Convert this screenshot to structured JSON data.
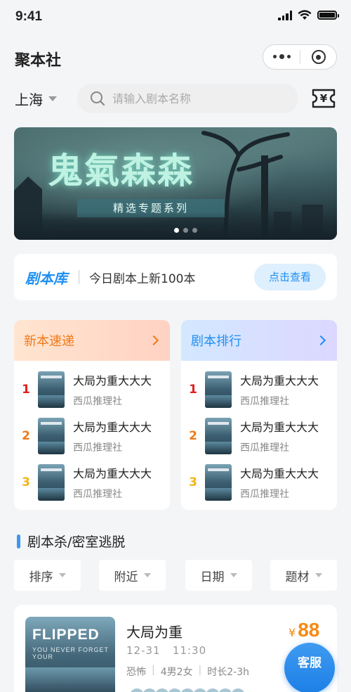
{
  "status_bar": {
    "time": "9:41"
  },
  "nav": {
    "title": "聚本社"
  },
  "location": {
    "city": "上海"
  },
  "search": {
    "placeholder": "请输入剧本名称"
  },
  "banner": {
    "title": "鬼氣森森",
    "subtitle": "精选专题系列",
    "pages": 3,
    "active_page": 1
  },
  "library": {
    "brand": "剧本库",
    "text": "今日剧本上新100本",
    "button": "点击查看"
  },
  "new_releases": {
    "title": "新本速递",
    "items": [
      {
        "rank": "1",
        "title": "大局为重大大大",
        "publisher": "西瓜推理社"
      },
      {
        "rank": "2",
        "title": "大局为重大大大",
        "publisher": "西瓜推理社"
      },
      {
        "rank": "3",
        "title": "大局为重大大大",
        "publisher": "西瓜推理社"
      }
    ]
  },
  "rankings": {
    "title": "剧本排行",
    "items": [
      {
        "rank": "1",
        "title": "大局为重大大大",
        "publisher": "西瓜推理社"
      },
      {
        "rank": "2",
        "title": "大局为重大大大",
        "publisher": "西瓜推理社"
      },
      {
        "rank": "3",
        "title": "大局为重大大大",
        "publisher": "西瓜推理社"
      }
    ]
  },
  "section": {
    "title": "剧本杀/密室逃脱"
  },
  "filters": [
    "排序",
    "附近",
    "日期",
    "题材"
  ],
  "listing": {
    "poster_title": "FLIPPED",
    "poster_subtitle": "YOU NEVER FORGET YOUR",
    "name": "大局为重",
    "date": "12-31",
    "time": "11:30",
    "genre": "恐怖",
    "cast": "4男2女",
    "duration": "时长2-3h",
    "currency": "¥",
    "price": "88"
  },
  "service_button": "客服",
  "colors": {
    "accent_blue": "#1f8ff2",
    "accent_orange": "#f07a1a",
    "rank1": "#e02020",
    "rank2": "#f07a1a",
    "rank3": "#f5b316"
  }
}
